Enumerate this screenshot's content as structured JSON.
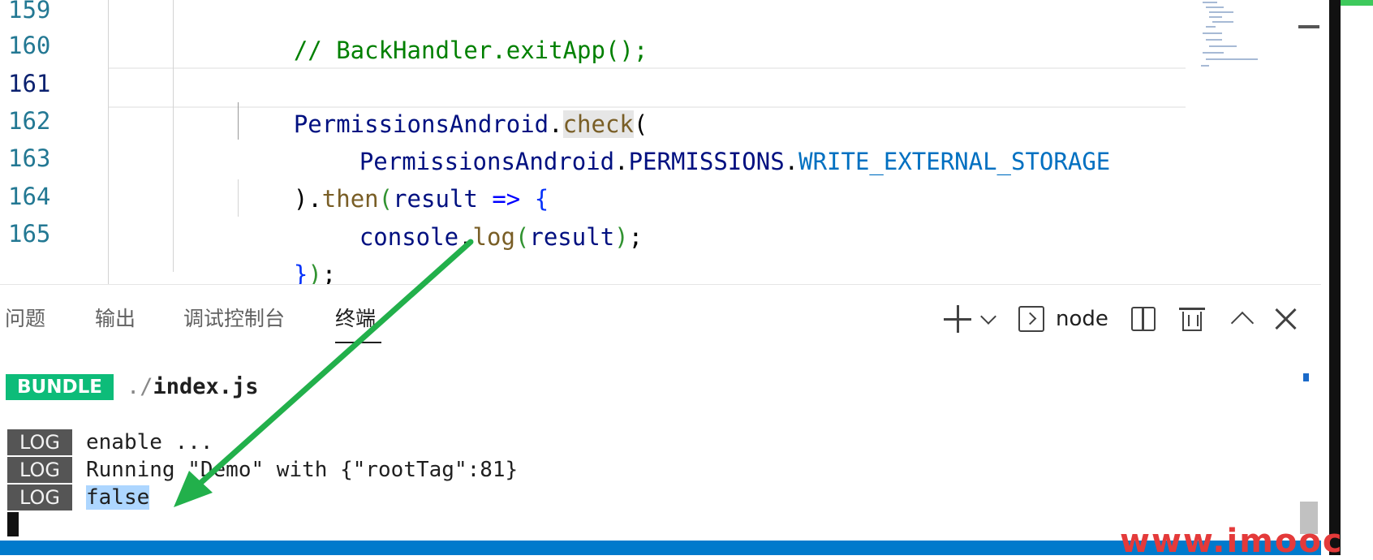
{
  "editor": {
    "line_numbers": [
      "159",
      "160",
      "161",
      "162",
      "163",
      "164",
      "165"
    ],
    "lines": {
      "l159": {
        "comment": "// BackHandler.exitApp();"
      },
      "l161": {
        "obj": "PermissionsAndroid",
        "dot": ".",
        "method": "check",
        "paren": "("
      },
      "l162": {
        "obj": "PermissionsAndroid",
        "dot1": ".",
        "prop": "PERMISSIONS",
        "dot2": ".",
        "const": "WRITE_EXTERNAL_STORAGE"
      },
      "l163": {
        "close": ")",
        "dot": ".",
        "method": "then",
        "paren": "(",
        "param": "result",
        "arrow": " => ",
        "brace": "{"
      },
      "l164": {
        "obj": "console",
        "dot": ".",
        "method": "log",
        "open": "(",
        "arg": "result",
        "close": ")",
        "semi": ";"
      },
      "l165": {
        "brace": "}",
        "paren": ")",
        "semi": ";"
      }
    }
  },
  "panel": {
    "tabs": [
      "问题",
      "输出",
      "调试控制台",
      "终端"
    ],
    "active_tab": "终端",
    "terminal_name": "node",
    "icons": [
      "plus-icon",
      "chevron-down-icon",
      "terminal-icon",
      "split-icon",
      "trash-icon",
      "chevron-up-icon",
      "close-icon"
    ]
  },
  "terminal": {
    "bundle_badge": "BUNDLE",
    "bundle_path_prefix": "./",
    "bundle_path": "index.js",
    "log_badge": "LOG",
    "logs": [
      "enable ...",
      "Running \"Demo\" with {\"rootTag\":81}",
      "false"
    ]
  },
  "watermark": "www.imooc",
  "colors": {
    "bundle_badge": "#0dbc79",
    "log_badge": "#555555",
    "statusbar": "#007acc",
    "annotation_arrow": "#22b04b",
    "selection": "#add6ff"
  }
}
